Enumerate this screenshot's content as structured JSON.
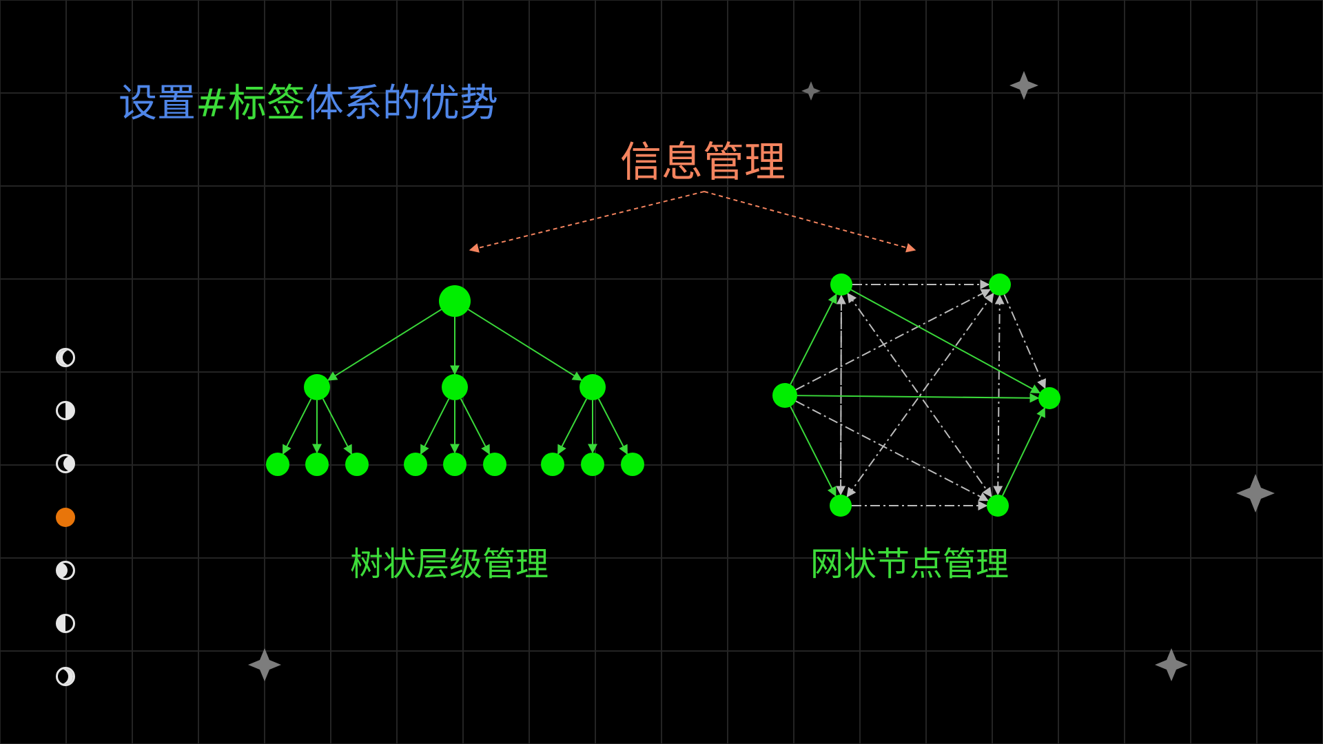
{
  "title": {
    "part1": "设置",
    "part2": "#标签",
    "part3": "体系的优势"
  },
  "info_title": "信息管理",
  "tree_label": "树状层级管理",
  "mesh_label": "网状节点管理",
  "colors": {
    "background": "#000000",
    "title_blue": "#4f86e8",
    "title_green": "#3ddc3a",
    "info_orange": "#f4845f",
    "node_green": "#00ee00",
    "edge_green": "#3ad93a",
    "dashed_gray": "#bdbdbd",
    "active_dot": "#e8750a",
    "star_gray": "#7d7d7d"
  },
  "side_nav": [
    {
      "style": "crescent-left",
      "active": false
    },
    {
      "style": "half-left",
      "active": false
    },
    {
      "style": "gibbous-left",
      "active": false
    },
    {
      "style": "full",
      "active": true
    },
    {
      "style": "gibbous-right",
      "active": false
    },
    {
      "style": "half-right",
      "active": false
    },
    {
      "style": "crescent-right",
      "active": false
    }
  ]
}
